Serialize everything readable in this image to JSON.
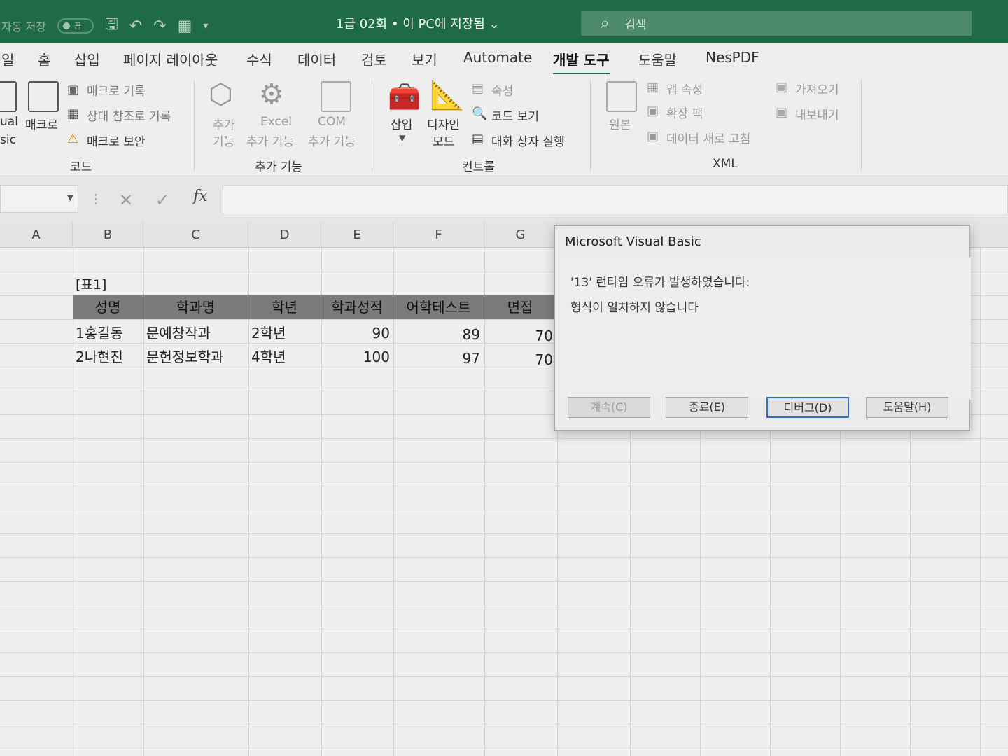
{
  "titlebar": {
    "autosave_label": "자동 저장",
    "autosave_state": "끔",
    "doc_title": "1급 02회 • 이 PC에 저장됨 ⌄",
    "search_placeholder": "검색",
    "bg_color": "#1f6b45"
  },
  "tabs": [
    "일",
    "홈",
    "삽입",
    "페이지 레이아웃",
    "수식",
    "데이터",
    "검토",
    "보기",
    "Automate",
    "개발 도구",
    "도움말",
    "NesPDF"
  ],
  "active_tab": "개발 도구",
  "ribbon": {
    "code": {
      "label": "코드",
      "vb_label_1": "ual",
      "vb_label_2": "sic",
      "macro_label": "매크로",
      "record_macro": "매크로 기록",
      "relative_ref": "상대 참조로 기록",
      "macro_security": "매크로 보안"
    },
    "addins": {
      "label": "추가 기능",
      "addin_1": "추가",
      "addin_2": "기능",
      "excel_1": "Excel",
      "excel_2": "추가 기능",
      "com_1": "COM",
      "com_2": "추가 기능"
    },
    "controls": {
      "label": "컨트롤",
      "insert": "삽입",
      "design_1": "디자인",
      "design_2": "모드",
      "properties": "속성",
      "view_code": "코드 보기",
      "run_dialog": "대화 상자 실행"
    },
    "xml": {
      "label": "XML",
      "source": "원본",
      "map_props": "맵 속성",
      "expansion": "확장 팩",
      "refresh": "데이터 새로 고침",
      "import": "가져오기",
      "export": "내보내기"
    }
  },
  "formula_bar": {
    "cancel_icon": "✕",
    "enter_icon": "✓",
    "fx": "fx",
    "value": ""
  },
  "columns": [
    "A",
    "B",
    "C",
    "D",
    "E",
    "F",
    "G"
  ],
  "sheet": {
    "caption": "[표1]",
    "headers": [
      "성명",
      "학과명",
      "학년",
      "학과성적",
      "어학테스트",
      "면접"
    ],
    "rows": [
      [
        "1홍길동",
        "문예창작과",
        "2학년",
        "90",
        "89",
        "70"
      ],
      [
        "2나현진",
        "문헌정보학과",
        "4학년",
        "100",
        "97",
        "70"
      ]
    ]
  },
  "dialog": {
    "title": "Microsoft Visual Basic",
    "message_1": "'13' 런타임 오류가 발생하였습니다:",
    "message_2": "형식이 일치하지 않습니다",
    "buttons": {
      "continue": "계속(C)",
      "end": "종료(E)",
      "debug": "디버그(D)",
      "help": "도움말(H)"
    }
  }
}
